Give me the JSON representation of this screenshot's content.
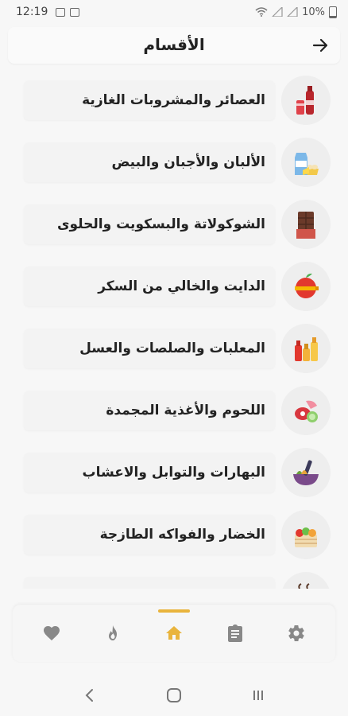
{
  "status_bar": {
    "time": "12:19",
    "battery_text": "10%"
  },
  "header": {
    "title": "الأقسام"
  },
  "categories": [
    {
      "label": "العصائر والمشروبات الغازية",
      "icon": "soda-drinks-icon"
    },
    {
      "label": "الألبان والأجبان والبيض",
      "icon": "dairy-eggs-icon"
    },
    {
      "label": "الشوكولاتة والبسكويت والحلوى",
      "icon": "chocolate-bar-icon"
    },
    {
      "label": "الدايت والخالي من السكر",
      "icon": "diet-apple-icon"
    },
    {
      "label": "المعلبات والصلصات والعسل",
      "icon": "sauce-bottles-icon"
    },
    {
      "label": "اللحوم والأغذية المجمدة",
      "icon": "meat-icon"
    },
    {
      "label": "البهارات والتوابل والاعشاب",
      "icon": "spices-mortar-icon"
    },
    {
      "label": "الخضار والفواكه الطازجة",
      "icon": "vegetable-basket-icon"
    }
  ],
  "bottom_nav": {
    "items": [
      {
        "name": "favorites",
        "icon": "heart-icon"
      },
      {
        "name": "hot",
        "icon": "flame-icon"
      },
      {
        "name": "home",
        "icon": "home-icon",
        "active": true
      },
      {
        "name": "orders",
        "icon": "clipboard-icon"
      },
      {
        "name": "settings",
        "icon": "gear-icon"
      }
    ]
  },
  "colors": {
    "accent": "#e9b43c",
    "nav_icon": "#888888",
    "background": "#f7f7f7"
  }
}
